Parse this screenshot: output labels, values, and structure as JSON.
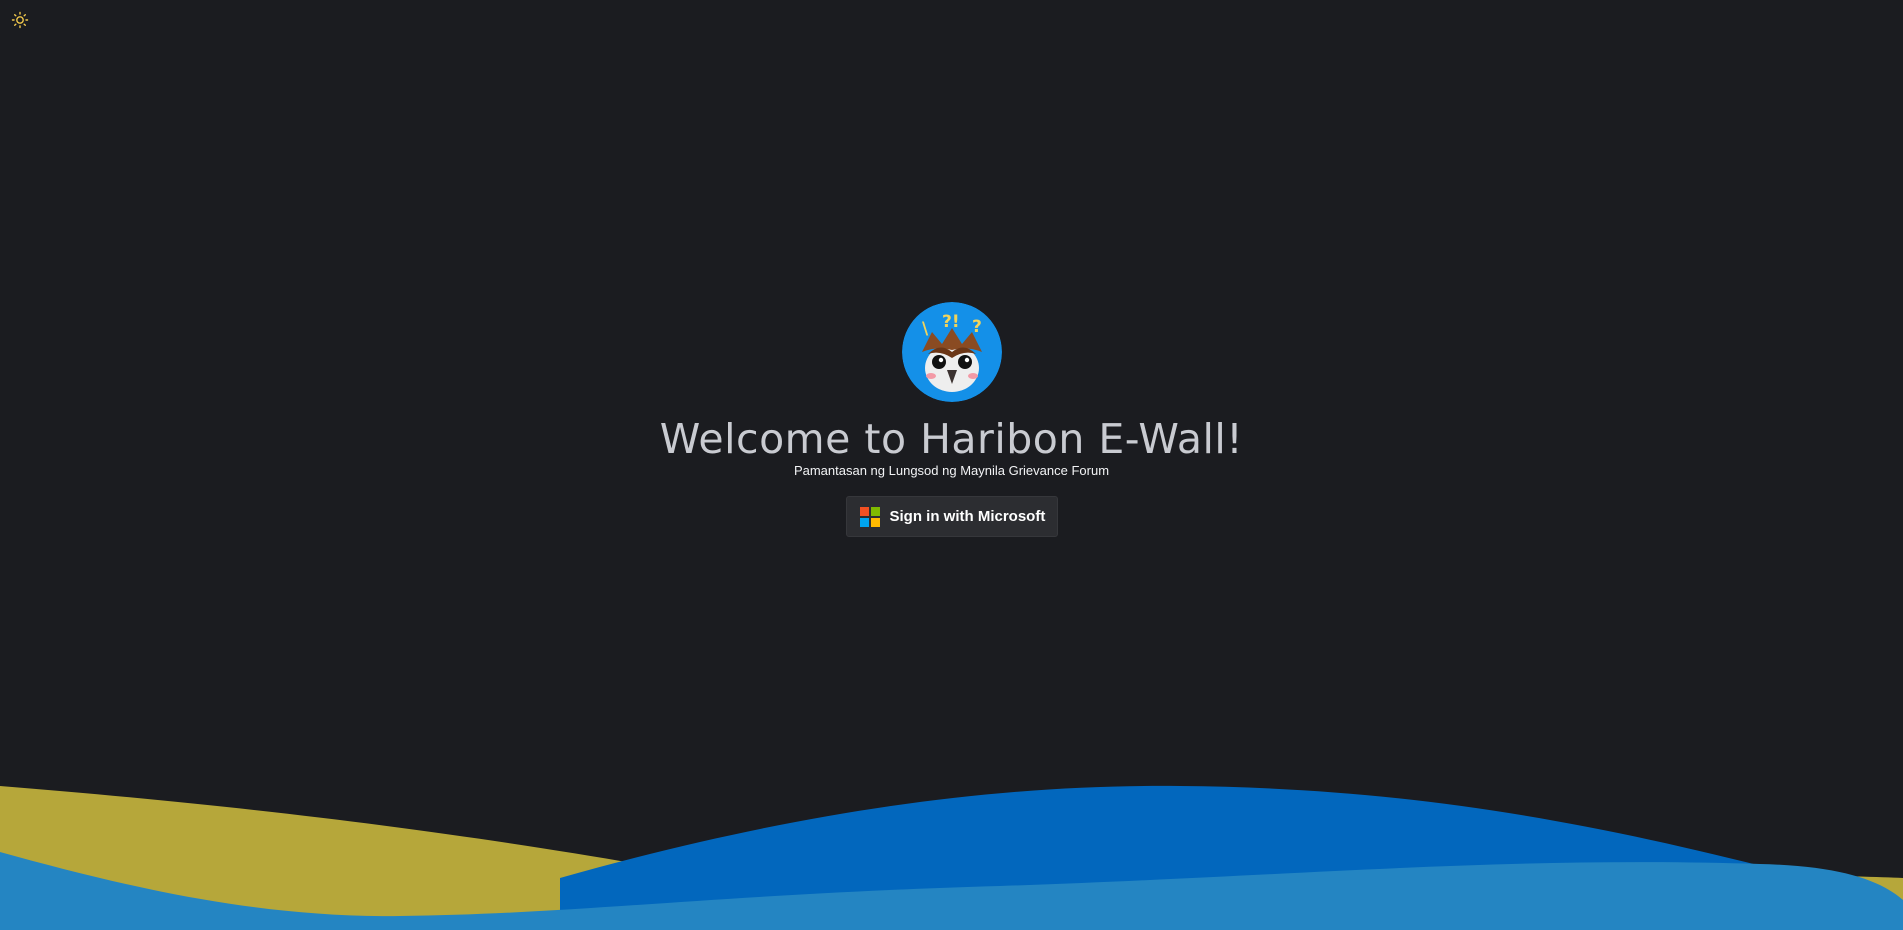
{
  "header": {
    "theme_toggle_icon": "sun-icon"
  },
  "main": {
    "logo_icon": "owl-mascot-icon",
    "title": "Welcome to Haribon E-Wall!",
    "subtitle": "Pamantasan ng Lungsod ng Maynila Grievance Forum",
    "signin_label": "Sign in with Microsoft",
    "signin_icon": "microsoft-logo-icon"
  },
  "colors": {
    "background": "#1b1c20",
    "sun": "#f2c94c",
    "logo_bg": "#1490e8",
    "wave_gold": "#b6a73a",
    "wave_blue": "#0267bd",
    "wave_light_blue": "#2485c2",
    "ms_red": "#f25022",
    "ms_green": "#7fba00",
    "ms_blue": "#00a4ef",
    "ms_yellow": "#ffb900"
  }
}
